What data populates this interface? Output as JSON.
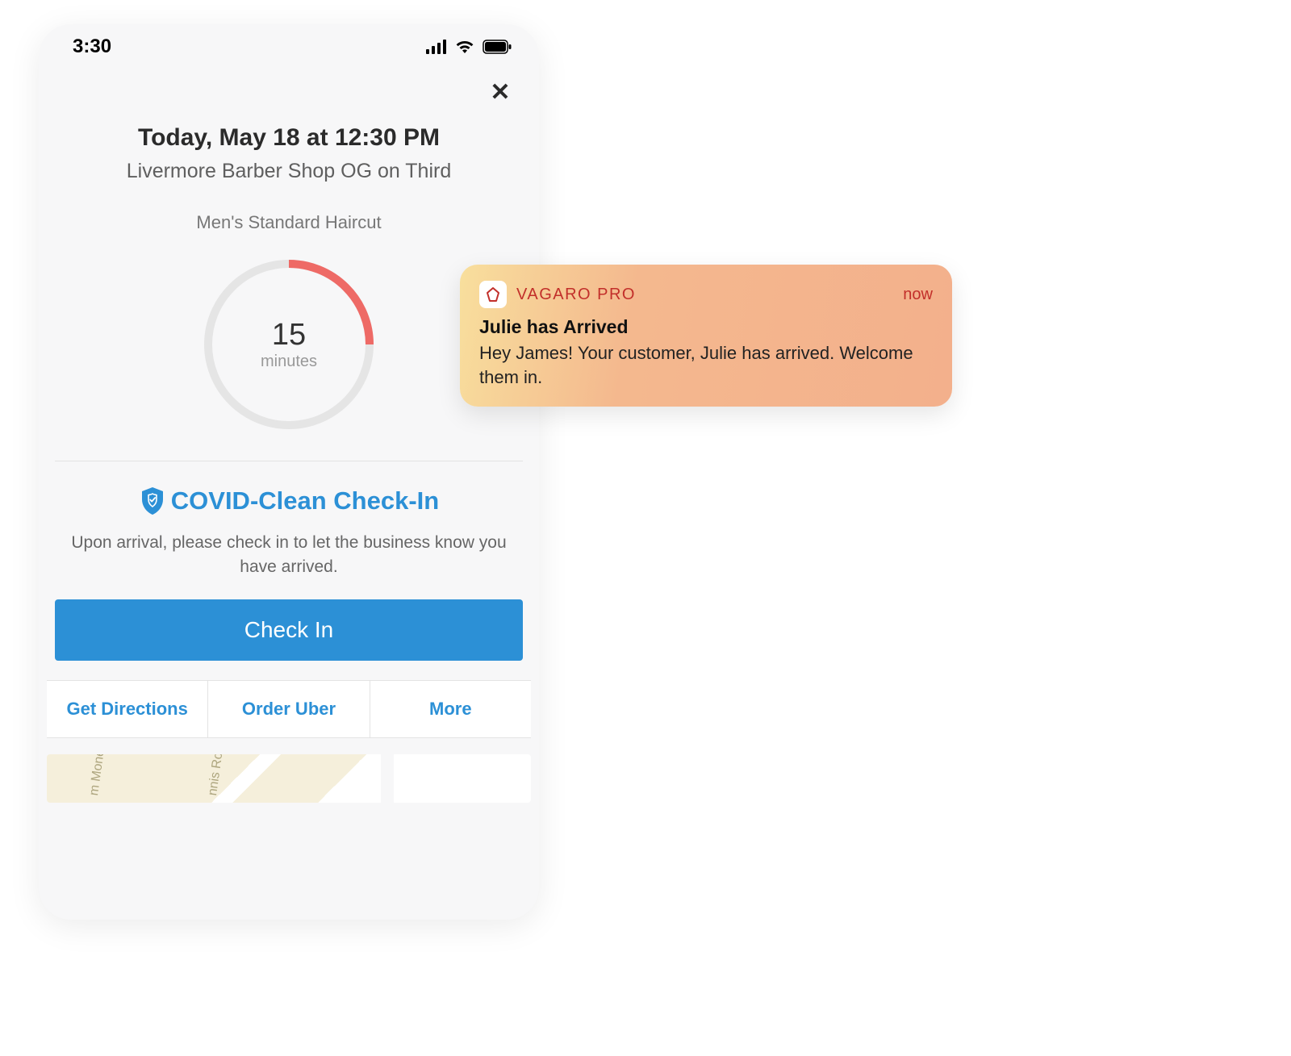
{
  "status_bar": {
    "time": "3:30"
  },
  "header": {
    "datetime": "Today, May 18 at 12:30 PM",
    "business": "Livermore Barber Shop OG on Third",
    "service": "Men's Standard Haircut"
  },
  "countdown": {
    "value": "15",
    "unit": "minutes"
  },
  "covid": {
    "title": "COVID-Clean Check-In",
    "desc": "Upon arrival, please check in to let the business know you have arrived.",
    "button": "Check In"
  },
  "actions": {
    "directions": "Get Directions",
    "uber": "Order Uber",
    "more": "More"
  },
  "map": {
    "street1": "m Moneg",
    "street2": "nnis Ros"
  },
  "notification": {
    "app": "VAGARO PRO",
    "time": "now",
    "title": "Julie has Arrived",
    "body": "Hey James! Your customer, Julie has arrived. Welcome them in."
  }
}
